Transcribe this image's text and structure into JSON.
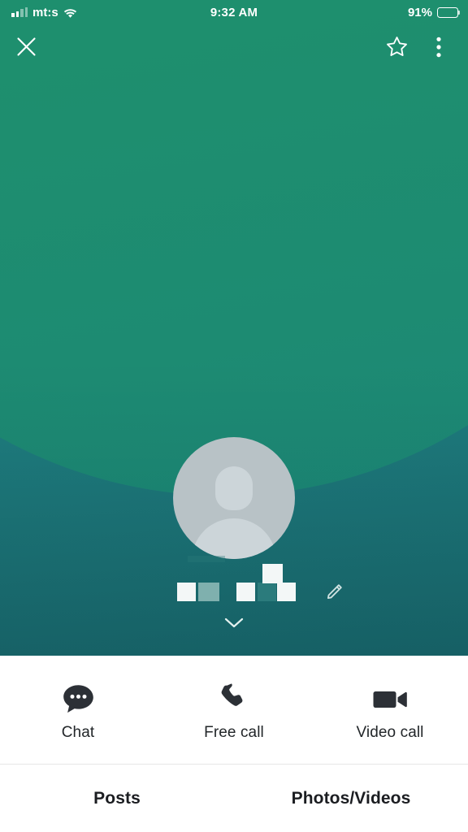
{
  "status_bar": {
    "carrier": "mt:s",
    "signal_icon": "signal-bars-icon",
    "wifi_icon": "wifi-icon",
    "time": "9:32 AM",
    "battery_percent": "91%",
    "battery_icon": "battery-icon",
    "battery_level": 91
  },
  "top_nav": {
    "close_icon": "close-icon",
    "favorite_icon": "star-outline-icon",
    "overflow_icon": "more-vertical-icon"
  },
  "profile": {
    "avatar_icon": "default-person-avatar-icon",
    "display_name": "",
    "name_is_censored": true,
    "edit_icon": "pencil-edit-icon",
    "expand_icon": "chevron-down-icon"
  },
  "actions": [
    {
      "label": "Chat",
      "icon": "chat-bubble-icon"
    },
    {
      "label": "Free call",
      "icon": "phone-icon"
    },
    {
      "label": "Video call",
      "icon": "video-camera-icon"
    }
  ],
  "tabs": [
    {
      "label": "Posts"
    },
    {
      "label": "Photos/Videos"
    }
  ],
  "colors": {
    "hero_green": "#1e8f6e",
    "hero_teal_top": "#24948e",
    "hero_teal_bottom": "#1a6a6f",
    "sheet_background": "#ffffff",
    "icon_dark": "#2c3036",
    "text_dark": "#1b1d21",
    "avatar_background": "#b8c2c6",
    "avatar_figure": "#ccd5d9"
  }
}
